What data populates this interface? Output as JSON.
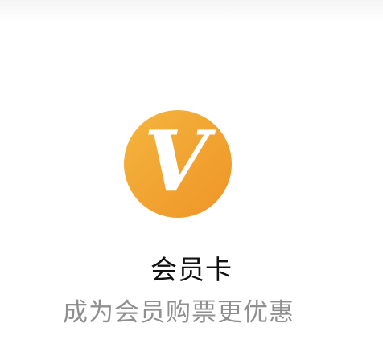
{
  "logo": {
    "letter": "V",
    "icon": "vip-v-icon",
    "colors": {
      "gradient_start": "#f4b63d",
      "gradient_end": "#ee9527",
      "letter": "#ffffff"
    }
  },
  "title": "会员卡",
  "subtitle": "成为会员购票更优惠"
}
